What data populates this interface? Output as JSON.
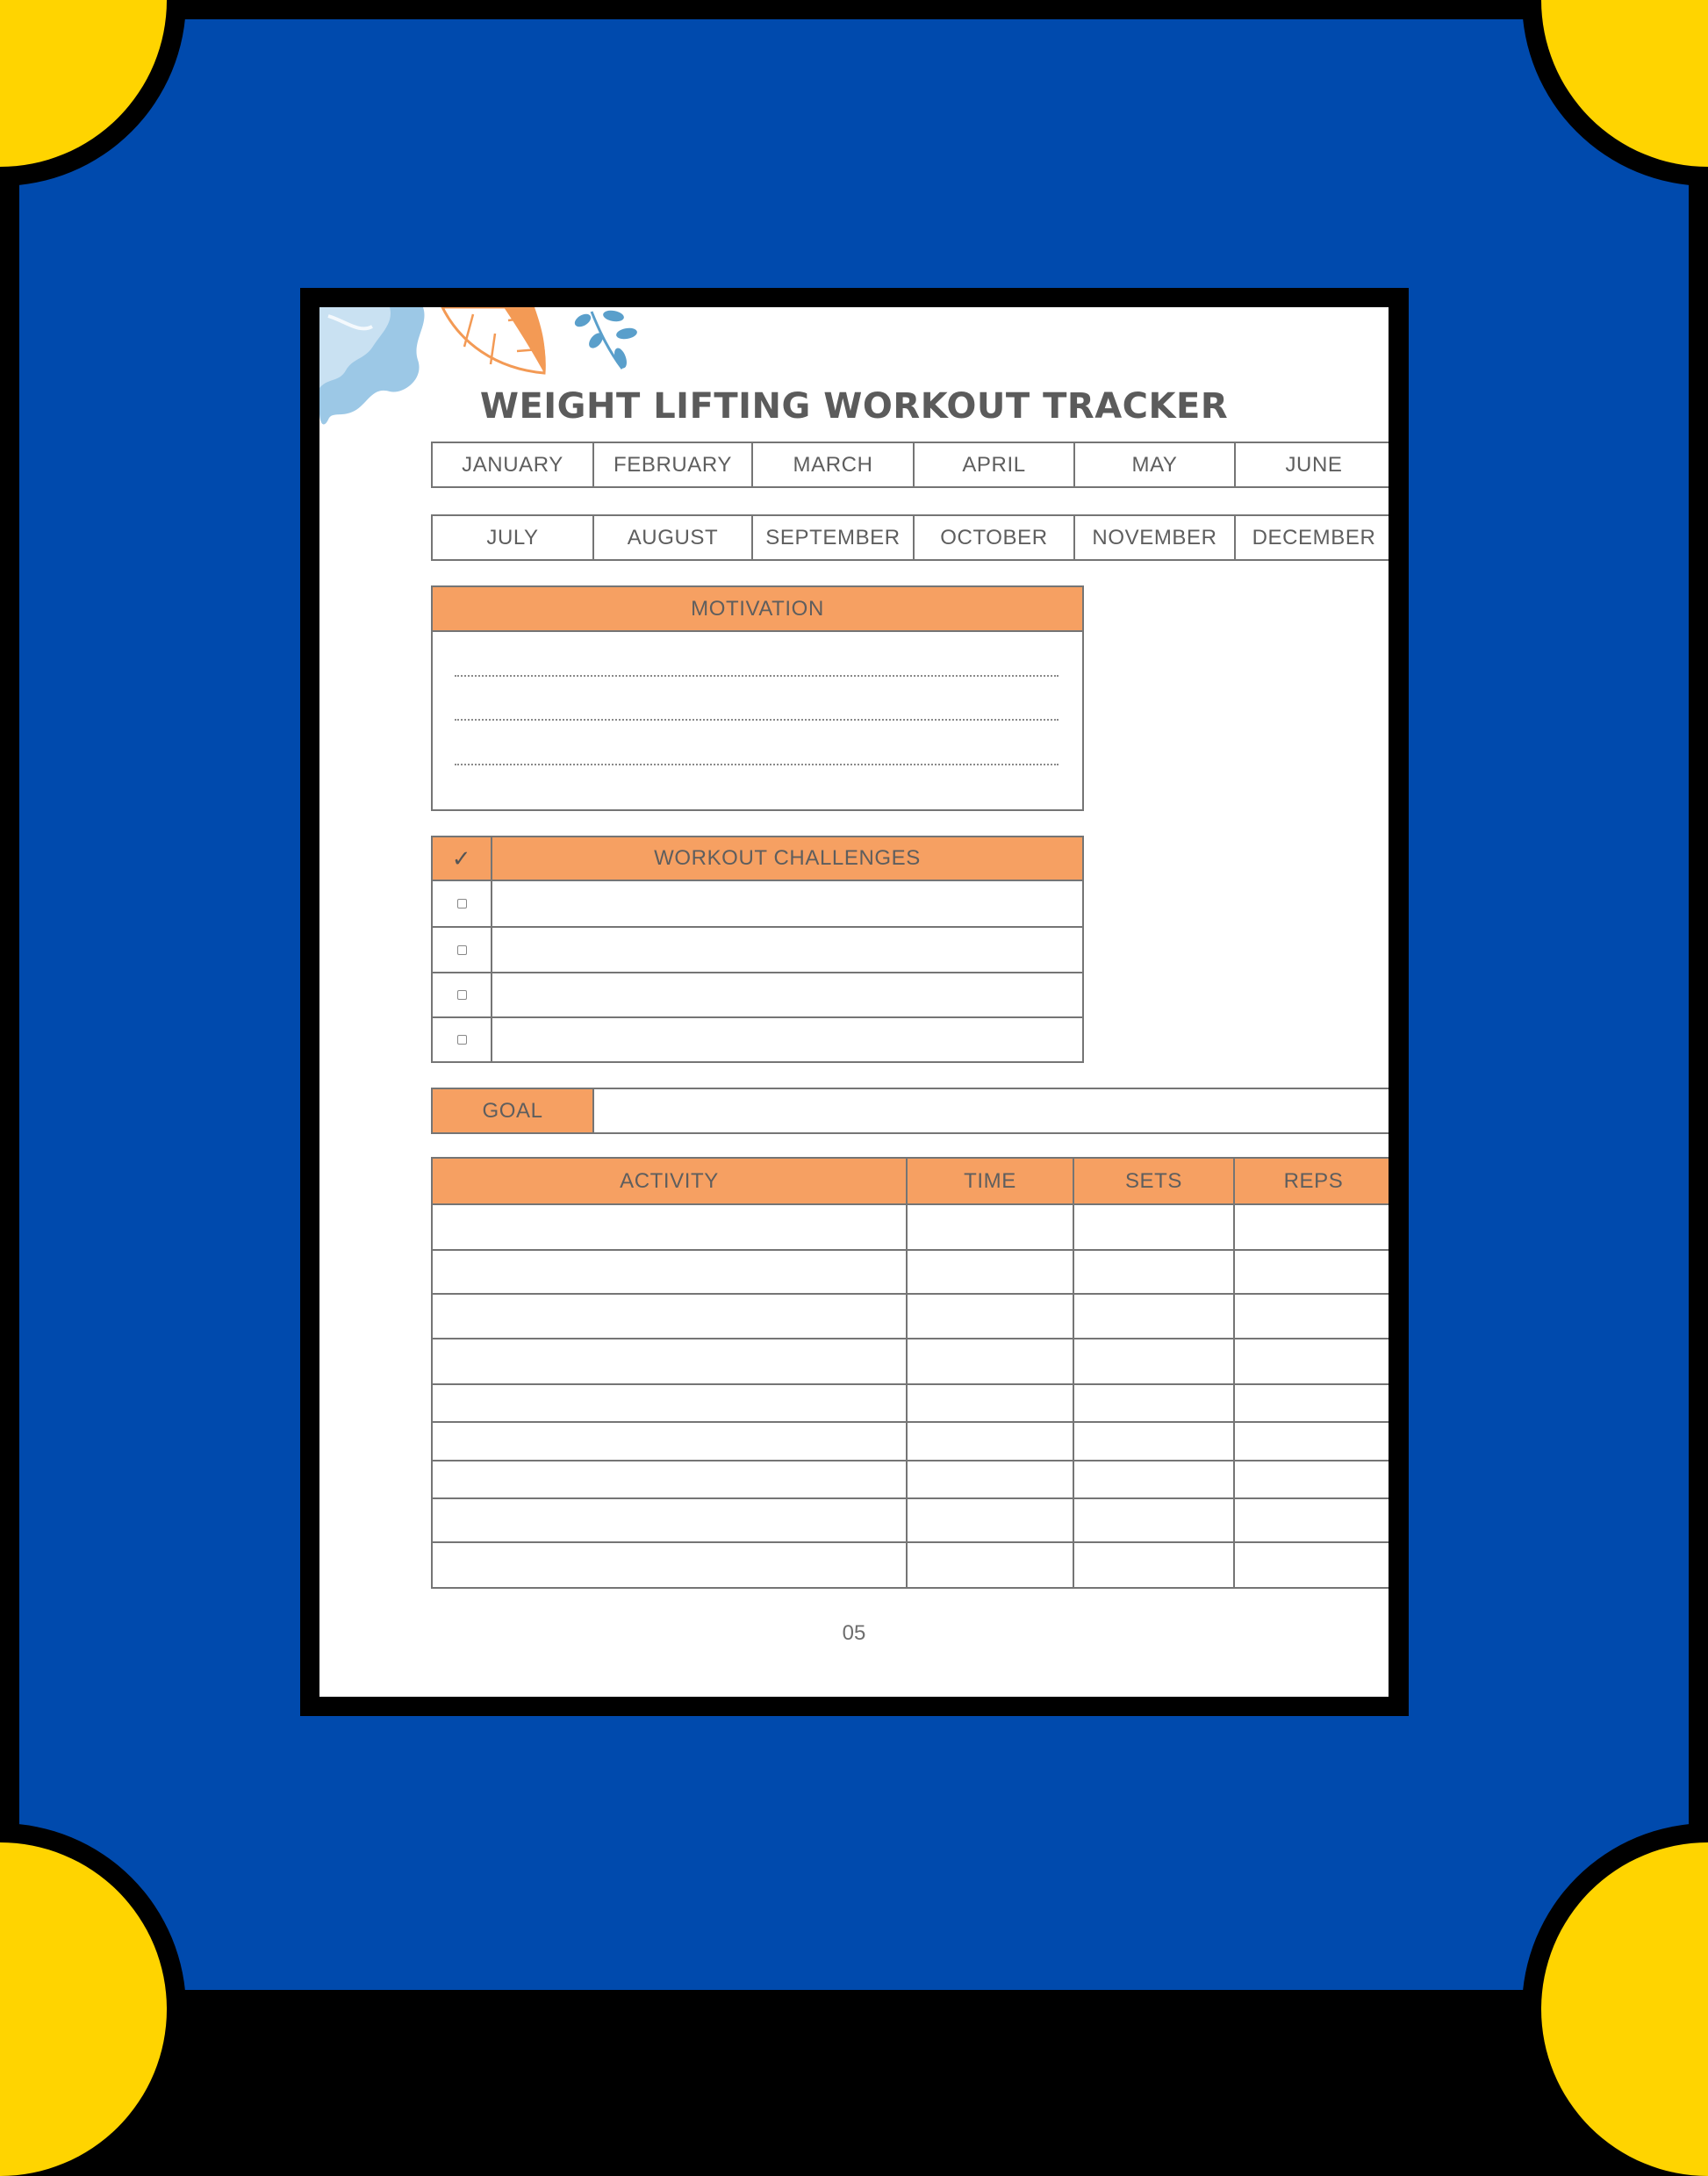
{
  "colors": {
    "background": "#004AAD",
    "corner_accent": "#FFD400",
    "frame": "#000000",
    "header_fill": "#F6A062",
    "text": "#5e5e5e"
  },
  "page": {
    "title": "WEIGHT LIFTING WORKOUT TRACKER",
    "page_number": "05"
  },
  "months": {
    "row1": [
      "JANUARY",
      "FEBRUARY",
      "MARCH",
      "APRIL",
      "MAY",
      "JUNE"
    ],
    "row2": [
      "JULY",
      "AUGUST",
      "SEPTEMBER",
      "OCTOBER",
      "NOVEMBER",
      "DECEMBER"
    ]
  },
  "motivation": {
    "header": "MOTIVATION",
    "lines": 3
  },
  "challenges": {
    "check_header_icon": "✓",
    "header": "WORKOUT CHALLENGES",
    "rows": [
      "",
      "",
      "",
      ""
    ]
  },
  "goal": {
    "label": "GOAL",
    "value": ""
  },
  "activity_table": {
    "columns": [
      "ACTIVITY",
      "TIME",
      "SETS",
      "REPS"
    ],
    "rows": [
      [
        "",
        "",
        "",
        ""
      ],
      [
        "",
        "",
        "",
        ""
      ],
      [
        "",
        "",
        "",
        ""
      ],
      [
        "",
        "",
        "",
        ""
      ],
      [
        "",
        "",
        "",
        ""
      ],
      [
        "",
        "",
        "",
        ""
      ],
      [
        "",
        "",
        "",
        ""
      ],
      [
        "",
        "",
        "",
        ""
      ],
      [
        "",
        "",
        "",
        ""
      ]
    ]
  }
}
